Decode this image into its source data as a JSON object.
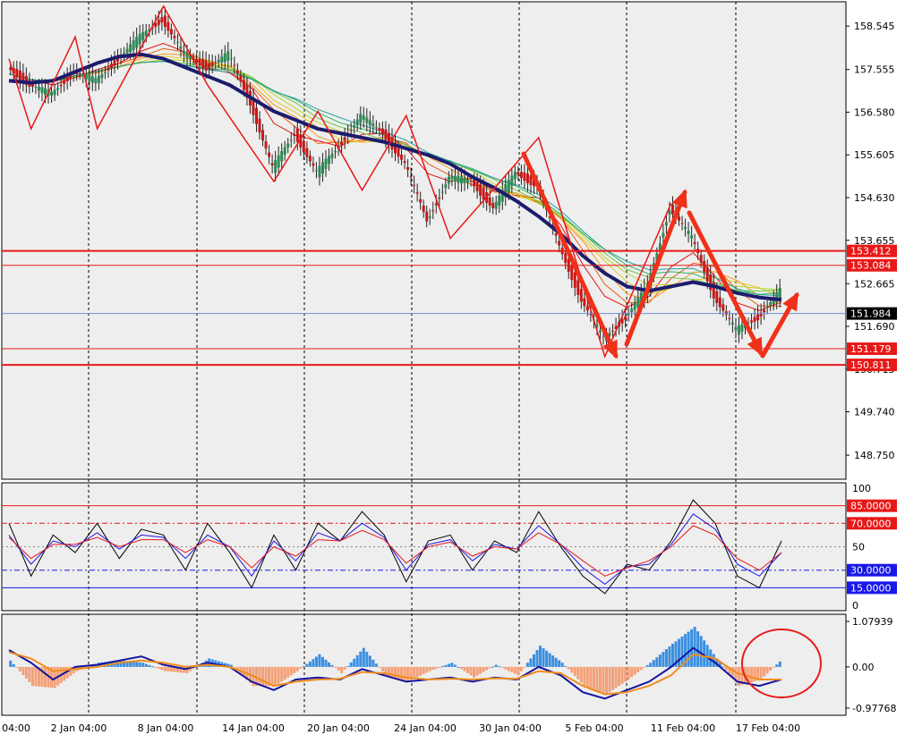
{
  "chart_data": [
    {
      "type": "candlestick",
      "panel": "main",
      "title": "",
      "y_ticks": [
        "158.545",
        "157.555",
        "156.580",
        "155.605",
        "154.630",
        "153.655",
        "152.665",
        "151.690",
        "150.715",
        "149.740",
        "148.750"
      ],
      "ylim": [
        148.2,
        159.1
      ],
      "x_labels": [
        "04:00",
        "2 Jan 04:00",
        "8 Jan 04:00",
        "14 Jan 04:00",
        "20 Jan 04:00",
        "24 Jan 04:00",
        "30 Jan 04:00",
        "5 Feb 04:00",
        "11 Feb 04:00",
        "17 Feb 04:00"
      ],
      "price_path": [
        157.6,
        157.2,
        157.0,
        157.5,
        157.3,
        157.8,
        158.3,
        158.7,
        157.9,
        157.6,
        157.9,
        156.8,
        155.3,
        156.1,
        155.2,
        155.8,
        156.5,
        156.1,
        155.4,
        154.1,
        155.1,
        155.0,
        154.4,
        155.2,
        154.9,
        153.5,
        152.3,
        151.4,
        151.9,
        152.6,
        154.4,
        153.7,
        152.4,
        151.6,
        151.9,
        152.5
      ],
      "moving_average": [
        157.3,
        157.25,
        157.3,
        157.5,
        157.7,
        157.85,
        157.9,
        157.8,
        157.6,
        157.4,
        157.2,
        156.9,
        156.6,
        156.4,
        156.2,
        156.1,
        156.0,
        155.9,
        155.75,
        155.6,
        155.4,
        155.1,
        154.85,
        154.55,
        154.2,
        153.8,
        153.3,
        152.9,
        152.6,
        152.5,
        152.6,
        152.7,
        152.6,
        152.45,
        152.35,
        152.3
      ],
      "levels": [
        {
          "value": 153.412,
          "label": "153.412",
          "color": "#e81818"
        },
        {
          "value": 153.084,
          "label": "153.084",
          "color": "#e81818"
        },
        {
          "value": 151.179,
          "label": "151.179",
          "color": "#e81818"
        },
        {
          "value": 150.811,
          "label": "150.811",
          "color": "#e81818"
        }
      ],
      "current_price": {
        "value": 151.984,
        "label": "151.984",
        "color": "#000000"
      },
      "colors": {
        "up": "#2e8b57",
        "down": "#c81818",
        "ma": "#1c1c6e",
        "zigzag": "#e81818",
        "arrow": "#f03018",
        "bid_line": "#6f8fdf"
      }
    },
    {
      "type": "line",
      "panel": "stochastic",
      "y_ticks": [
        "100",
        "50",
        "0"
      ],
      "ylim": [
        0,
        100
      ],
      "levels": [
        {
          "value": 85,
          "label": "85.0000",
          "color": "#e81818"
        },
        {
          "value": 70,
          "label": "70.0000",
          "color": "#e81818"
        },
        {
          "value": 30,
          "label": "30.0000",
          "color": "#1818e8"
        },
        {
          "value": 15,
          "label": "15.0000",
          "color": "#1818e8"
        }
      ],
      "series": [
        {
          "values": [
            70,
            25,
            60,
            45,
            70,
            40,
            65,
            60,
            30,
            70,
            45,
            15,
            60,
            30,
            70,
            55,
            80,
            60,
            20,
            55,
            60,
            30,
            55,
            45,
            80,
            50,
            25,
            10,
            35,
            30,
            55,
            90,
            70,
            25,
            15,
            55
          ]
        },
        {
          "values": [
            60,
            35,
            55,
            50,
            62,
            48,
            60,
            58,
            40,
            60,
            50,
            25,
            55,
            38,
            62,
            55,
            70,
            58,
            30,
            52,
            56,
            38,
            52,
            48,
            68,
            52,
            32,
            18,
            33,
            35,
            52,
            78,
            65,
            35,
            25,
            45
          ]
        },
        {
          "values": [
            58,
            40,
            52,
            52,
            58,
            50,
            56,
            56,
            45,
            56,
            50,
            32,
            50,
            42,
            56,
            55,
            64,
            56,
            36,
            50,
            54,
            42,
            50,
            48,
            62,
            52,
            38,
            25,
            32,
            38,
            50,
            68,
            60,
            40,
            30,
            45
          ]
        }
      ]
    },
    {
      "type": "bar",
      "panel": "macd",
      "y_ticks": [
        "1.07939",
        "0.00",
        "-0.97768"
      ],
      "ylim": [
        -0.97768,
        1.07939
      ],
      "histogram": [
        0.15,
        -0.45,
        -0.5,
        -0.1,
        0.1,
        0.15,
        0.1,
        -0.1,
        -0.15,
        0.2,
        0.05,
        -0.45,
        -0.45,
        -0.1,
        0.3,
        -0.15,
        0.45,
        -0.2,
        -0.35,
        -0.1,
        0.1,
        -0.25,
        0.05,
        -0.2,
        0.5,
        0.1,
        -0.45,
        -0.65,
        -0.3,
        0.1,
        0.55,
        0.95,
        0.2,
        -0.45,
        -0.3,
        0.2
      ],
      "series": [
        {
          "values": [
            0.4,
            0.1,
            -0.3,
            0.0,
            0.05,
            0.15,
            0.25,
            0.05,
            -0.05,
            0.1,
            0.0,
            -0.35,
            -0.55,
            -0.3,
            -0.25,
            -0.3,
            -0.05,
            -0.2,
            -0.35,
            -0.3,
            -0.25,
            -0.35,
            -0.25,
            -0.3,
            0.0,
            -0.2,
            -0.6,
            -0.75,
            -0.55,
            -0.35,
            0.0,
            0.45,
            0.1,
            -0.35,
            -0.45,
            -0.3
          ]
        },
        {
          "values": [
            0.35,
            0.2,
            -0.1,
            -0.05,
            0.0,
            0.1,
            0.15,
            0.1,
            0.0,
            0.05,
            0.0,
            -0.2,
            -0.45,
            -0.35,
            -0.3,
            -0.28,
            -0.12,
            -0.15,
            -0.25,
            -0.3,
            -0.28,
            -0.3,
            -0.27,
            -0.28,
            -0.1,
            -0.15,
            -0.45,
            -0.65,
            -0.6,
            -0.45,
            -0.2,
            0.3,
            0.2,
            -0.15,
            -0.3,
            -0.3
          ]
        }
      ],
      "colors": {
        "pos": "#3a8fe0",
        "neg": "#f3a078",
        "line1": "#1414a0",
        "line2": "#f08c1c",
        "circle": "#e81818"
      }
    }
  ]
}
